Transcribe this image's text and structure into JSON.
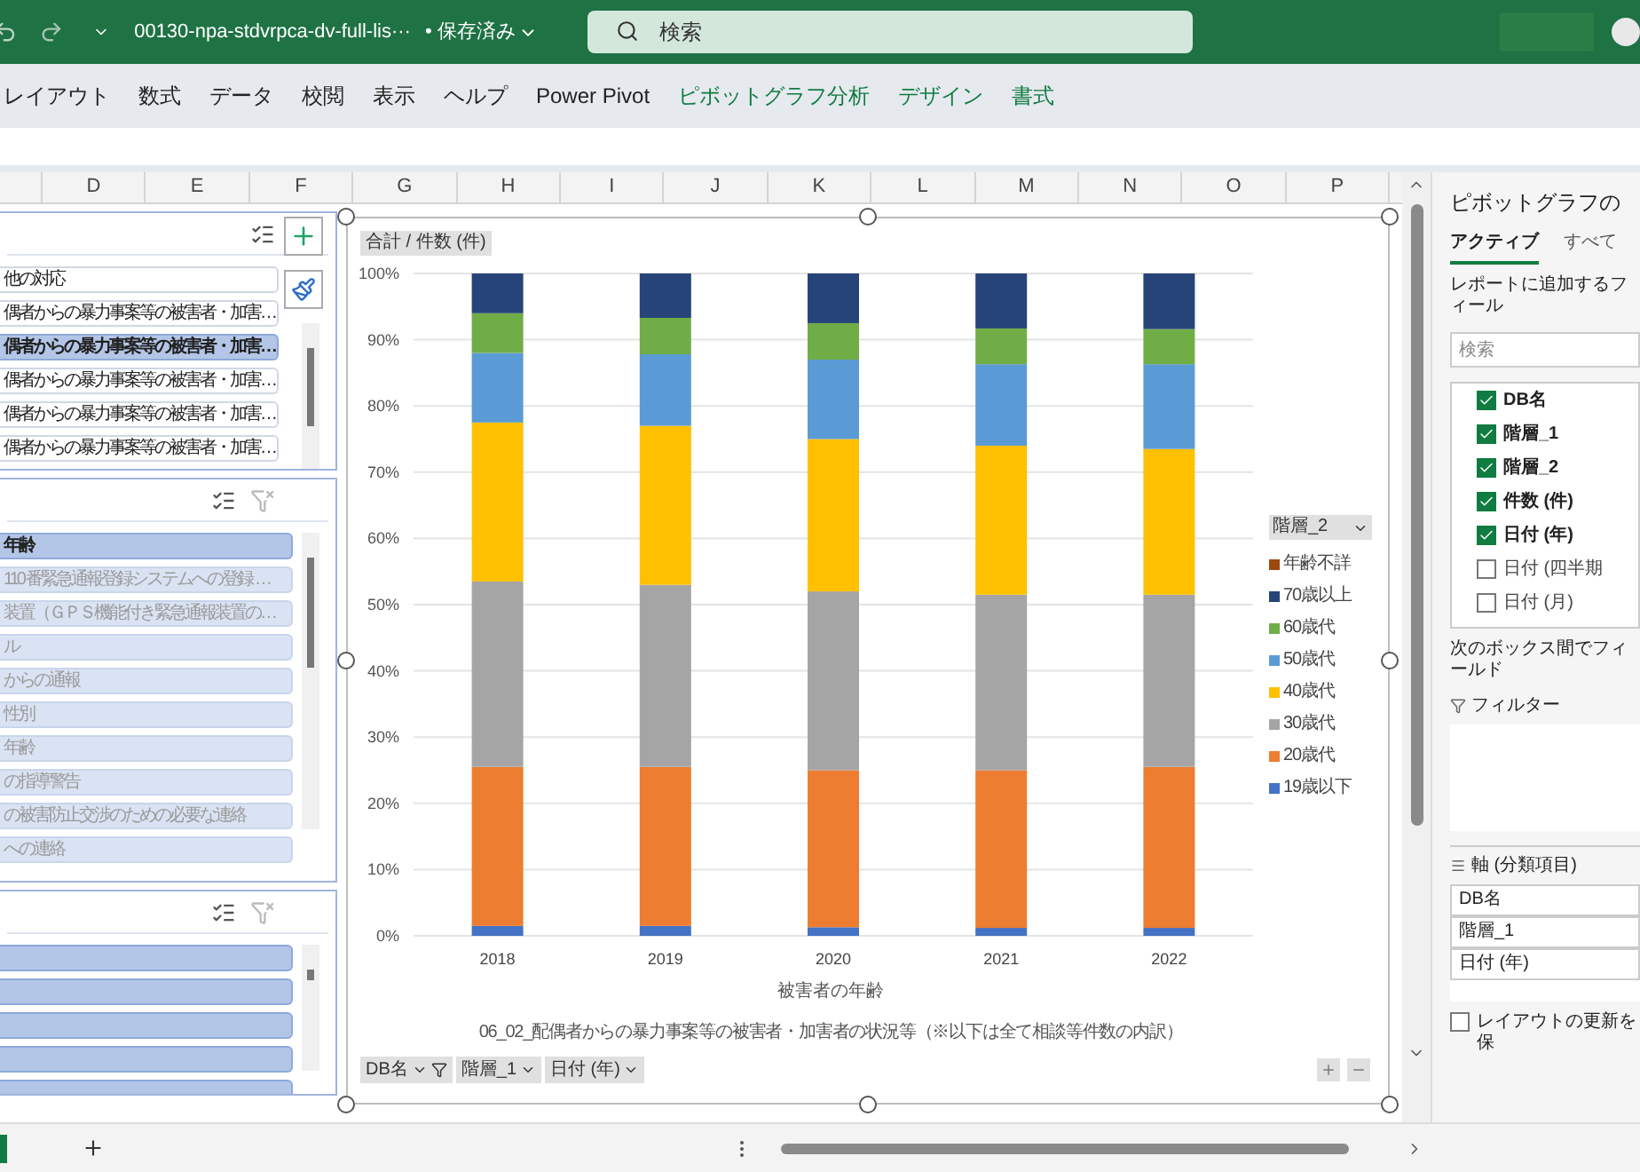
{
  "title_bar": {
    "file_name": "00130-npa-stdvrpca-dv-full-lis···",
    "save_status": "• 保存済み",
    "search": {
      "placeholder": "検索"
    }
  },
  "ribbon_tabs": [
    {
      "label": "レイアウト",
      "kind": "standard"
    },
    {
      "label": "数式",
      "kind": "standard"
    },
    {
      "label": "データ",
      "kind": "standard"
    },
    {
      "label": "校閲",
      "kind": "standard"
    },
    {
      "label": "表示",
      "kind": "standard"
    },
    {
      "label": "ヘルプ",
      "kind": "standard"
    },
    {
      "label": "Power Pivot",
      "kind": "standard"
    },
    {
      "label": "ピボットグラフ分析",
      "kind": "contextual"
    },
    {
      "label": "デザイン",
      "kind": "contextual"
    },
    {
      "label": "書式",
      "kind": "contextual"
    }
  ],
  "column_headers": [
    "D",
    "E",
    "F",
    "G",
    "H",
    "I",
    "J",
    "K",
    "L",
    "M",
    "N",
    "O",
    "P"
  ],
  "slicers": [
    {
      "items": [
        {
          "label": "他の対応",
          "selected": false
        },
        {
          "label": "偶者からの暴力事案等の被害者・加害…",
          "selected": false
        },
        {
          "label": "偶者からの暴力事案等の被害者・加害…",
          "selected": true
        },
        {
          "label": "偶者からの暴力事案等の被害者・加害…",
          "selected": false
        },
        {
          "label": "偶者からの暴力事案等の被害者・加害…",
          "selected": false
        },
        {
          "label": "偶者からの暴力事案等の被害者・加害…",
          "selected": false
        }
      ]
    },
    {
      "items": [
        {
          "label": "年齢",
          "selected": true,
          "available": true
        },
        {
          "label": "110 番緊急通報登録システムへの登録 …",
          "selected": false,
          "available": false
        },
        {
          "label": "装置（ＧＰＳ機能付き緊急通報装置の…",
          "selected": false,
          "available": false
        },
        {
          "label": "ル",
          "selected": false,
          "available": false
        },
        {
          "label": "からの通報",
          "selected": false,
          "available": false
        },
        {
          "label": "性別",
          "selected": false,
          "available": false
        },
        {
          "label": "年齢",
          "selected": false,
          "available": false
        },
        {
          "label": "の指導警告",
          "selected": false,
          "available": false
        },
        {
          "label": "の被害防止交渉のための必要な連絡",
          "selected": false,
          "available": false
        },
        {
          "label": "への連絡",
          "selected": false,
          "available": false
        }
      ]
    },
    {
      "items": [
        {
          "selected": true
        },
        {
          "selected": true
        },
        {
          "selected": true
        },
        {
          "selected": true
        },
        {
          "selected": true
        }
      ]
    }
  ],
  "chart": {
    "value_field": "合計 / 件数 (件)",
    "legend_field": "階層_2",
    "axis_group_labels": [
      "被害者の年齢",
      "06_02_配偶者からの暴力事案等の被害者・加害者の状況等（※以下は全て相談等件数の内訳）"
    ],
    "axis_fields": [
      {
        "label": "DB名",
        "filtered": true
      },
      {
        "label": "階層_1",
        "filtered": false
      },
      {
        "label": "日付 (年)",
        "filtered": false
      }
    ],
    "chart_data": {
      "type": "bar",
      "stacked": true,
      "orientation": "vertical",
      "grid": true,
      "legend": true,
      "categories": [
        "2018",
        "2019",
        "2020",
        "2021",
        "2022"
      ],
      "ylim": [
        0,
        100
      ],
      "yticks": [
        {
          "value": 0,
          "label": "0%"
        },
        {
          "value": 10,
          "label": "10%"
        },
        {
          "value": 20,
          "label": "20%"
        },
        {
          "value": 30,
          "label": "30%"
        },
        {
          "value": 40,
          "label": "40%"
        },
        {
          "value": 50,
          "label": "50%"
        },
        {
          "value": 60,
          "label": "60%"
        },
        {
          "value": 70,
          "label": "70%"
        },
        {
          "value": 80,
          "label": "80%"
        },
        {
          "value": 90,
          "label": "90%"
        },
        {
          "value": 100,
          "label": "100%"
        }
      ],
      "series": [
        {
          "name": "19歳以下",
          "color": "#4472c4",
          "values": [
            1.5,
            1.5,
            1.3,
            1.2,
            1.2
          ]
        },
        {
          "name": "20歳代",
          "color": "#ed7d31",
          "values": [
            24.0,
            24.0,
            23.7,
            23.8,
            24.3
          ]
        },
        {
          "name": "30歳代",
          "color": "#a5a5a5",
          "values": [
            28.0,
            27.5,
            27.0,
            26.5,
            26.0
          ]
        },
        {
          "name": "40歳代",
          "color": "#ffc000",
          "values": [
            24.0,
            24.0,
            23.0,
            22.5,
            22.0
          ]
        },
        {
          "name": "50歳代",
          "color": "#5b9bd5",
          "values": [
            10.5,
            10.8,
            12.0,
            12.3,
            12.8
          ]
        },
        {
          "name": "60歳代",
          "color": "#70ad47",
          "values": [
            6.0,
            5.5,
            5.5,
            5.4,
            5.3
          ]
        },
        {
          "name": "70歳以上",
          "color": "#264478",
          "values": [
            6.0,
            6.7,
            7.5,
            8.3,
            8.4
          ]
        },
        {
          "name": "年齢不詳",
          "color": "#9e480e",
          "values": [
            0,
            0,
            0,
            0,
            0
          ]
        }
      ]
    }
  },
  "field_pane": {
    "title": "ピボットグラフの",
    "tabs": [
      {
        "label": "アクティブ",
        "selected": true
      },
      {
        "label": "すべて",
        "selected": false
      }
    ],
    "instruction": "レポートに追加するフィール",
    "search": {
      "placeholder": "検索"
    },
    "fields": [
      {
        "label": "DB名",
        "checked": true
      },
      {
        "label": "階層_1",
        "checked": true
      },
      {
        "label": "階層_2",
        "checked": true
      },
      {
        "label": "件数 (件)",
        "checked": true
      },
      {
        "label": "日付 (年)",
        "checked": true
      },
      {
        "label": "日付 (四半期",
        "checked": false
      },
      {
        "label": "日付 (月)",
        "checked": false
      }
    ],
    "areas_instruction": "次のボックス間でフィールド",
    "filter_area": {
      "label": "フィルター"
    },
    "axis_area": {
      "label": "軸 (分類項目)",
      "items": [
        "DB名",
        "階層_1",
        "日付 (年)"
      ]
    },
    "defer_update": {
      "label": "レイアウトの更新を保",
      "checked": false
    }
  }
}
